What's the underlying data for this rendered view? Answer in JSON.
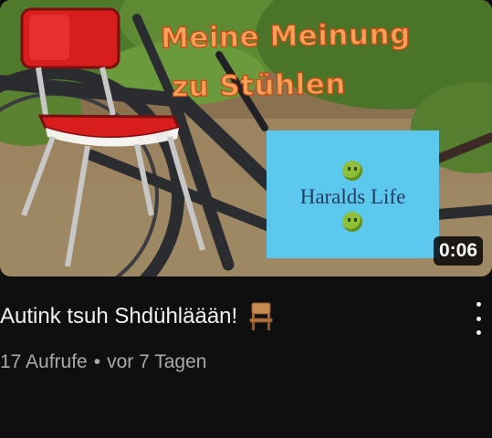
{
  "video": {
    "thumbnail": {
      "title_line1": "Meine Meinung",
      "title_line2": "zu Stühlen",
      "logo_text": "Haralds Life",
      "logo_icon": "nauseated-face-icon",
      "title_color": "#f6a15a",
      "logo_color": "#5dc8ee"
    },
    "duration": "0:06",
    "title": "Autink tsuh Shdühläään!",
    "title_icon": "chair-icon",
    "views": "17 Aufrufe",
    "separator": "•",
    "uploaded": "vor 7 Tagen"
  },
  "colors": {
    "background": "#0f0f0f",
    "title_text": "#f1f1f1",
    "meta_text": "#aaaaaa"
  }
}
